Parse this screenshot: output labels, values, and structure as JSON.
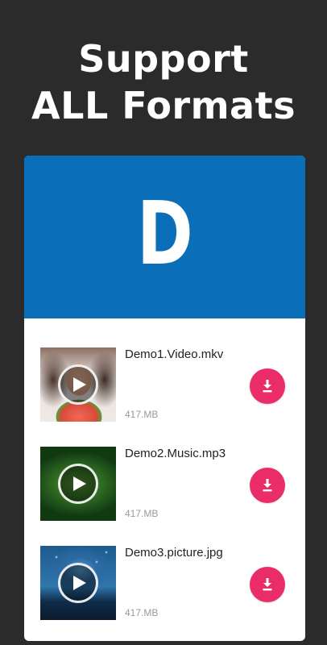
{
  "headline": {
    "line1": "Support",
    "line2": "ALL Formats"
  },
  "banner": {
    "letter": "D",
    "color": "#0a6eb9"
  },
  "files": [
    {
      "name": "Demo1.Video.mkv",
      "size": "417.MB",
      "thumbnail": "video-thumbnail",
      "action_icon": "download-icon"
    },
    {
      "name": "Demo2.Music.mp3",
      "size": "417.MB",
      "thumbnail": "music-thumbnail",
      "action_icon": "download-icon"
    },
    {
      "name": "Demo3.picture.jpg",
      "size": "417.MB",
      "thumbnail": "picture-thumbnail",
      "action_icon": "download-icon"
    }
  ],
  "colors": {
    "background": "#2a2b2a",
    "accent": "#ea2d68",
    "card": "#ffffff"
  }
}
